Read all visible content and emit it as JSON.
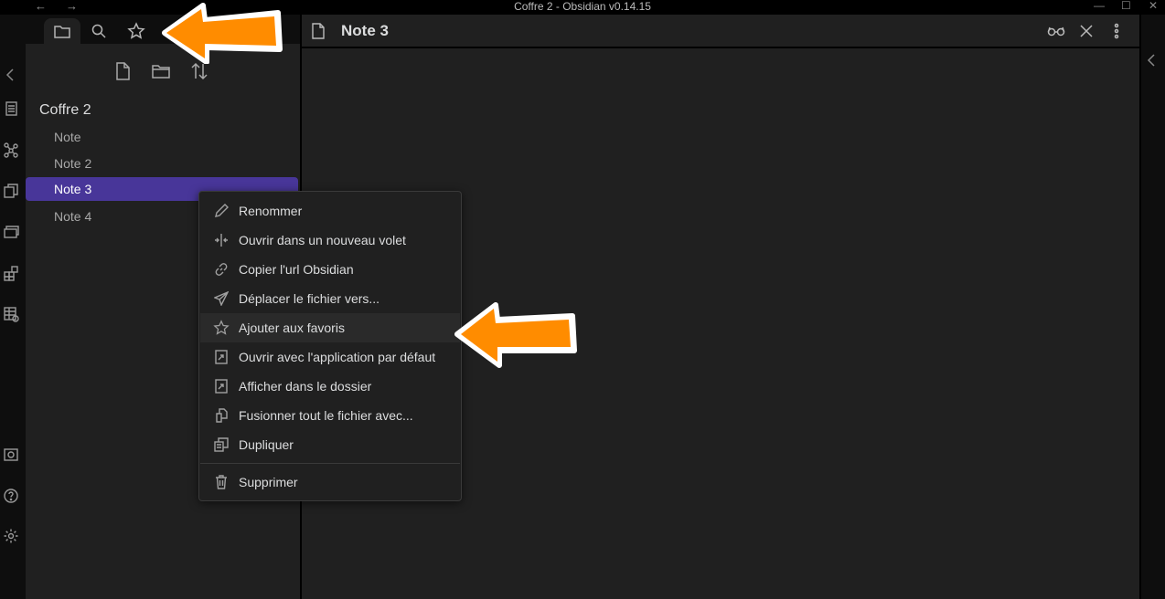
{
  "window": {
    "title": "Coffre 2 - Obsidian v0.14.15",
    "back": "←",
    "forward": "→",
    "minimize": "—",
    "maximize": "☐",
    "close": "✕"
  },
  "sidebar": {
    "tabs": [
      {
        "name": "tab-file-explorer",
        "icon": "folder-icon",
        "active": true
      },
      {
        "name": "tab-search",
        "icon": "search-icon",
        "active": false
      },
      {
        "name": "tab-starred",
        "icon": "star-icon",
        "active": false
      }
    ],
    "tools": [
      {
        "icon": "new-note-icon"
      },
      {
        "icon": "new-folder-icon"
      },
      {
        "icon": "sort-icon"
      }
    ],
    "vault_name": "Coffre 2",
    "files": [
      {
        "label": "Note",
        "selected": false
      },
      {
        "label": "Note 2",
        "selected": false
      },
      {
        "label": "Note 3",
        "selected": true
      },
      {
        "label": "Note 4",
        "selected": false
      }
    ]
  },
  "ribbon": {
    "icons": [
      "left-collapse-icon",
      "switcher-icon",
      "graph-view-icon",
      "templates-icon",
      "slides-icon",
      "canvas-icon",
      "table-icon",
      "vault-icon",
      "help-icon",
      "settings-icon"
    ]
  },
  "pane": {
    "title": "Note 3",
    "actions": [
      "reading-view-icon",
      "close-icon",
      "more-options-icon"
    ]
  },
  "context_menu": {
    "items": [
      {
        "label": "Renommer",
        "icon": "pencil-icon"
      },
      {
        "label": "Ouvrir dans un nouveau volet",
        "icon": "split-icon"
      },
      {
        "label": "Copier l'url Obsidian",
        "icon": "link-icon"
      },
      {
        "label": "Déplacer le fichier vers...",
        "icon": "paper-plane-icon"
      },
      {
        "label": "Ajouter aux favoris",
        "icon": "star-icon",
        "hovered": true
      },
      {
        "label": "Ouvrir avec l'application par défaut",
        "icon": "open-external-icon"
      },
      {
        "label": "Afficher dans le dossier",
        "icon": "show-in-folder-icon"
      },
      {
        "label": "Fusionner tout le fichier avec...",
        "icon": "merge-icon"
      },
      {
        "label": "Dupliquer",
        "icon": "duplicate-icon"
      },
      {
        "label": "Supprimer",
        "icon": "trash-icon"
      }
    ]
  },
  "colors": {
    "accent": "#483699",
    "background": "#202020",
    "annotation_arrow": "#ff8c00"
  }
}
